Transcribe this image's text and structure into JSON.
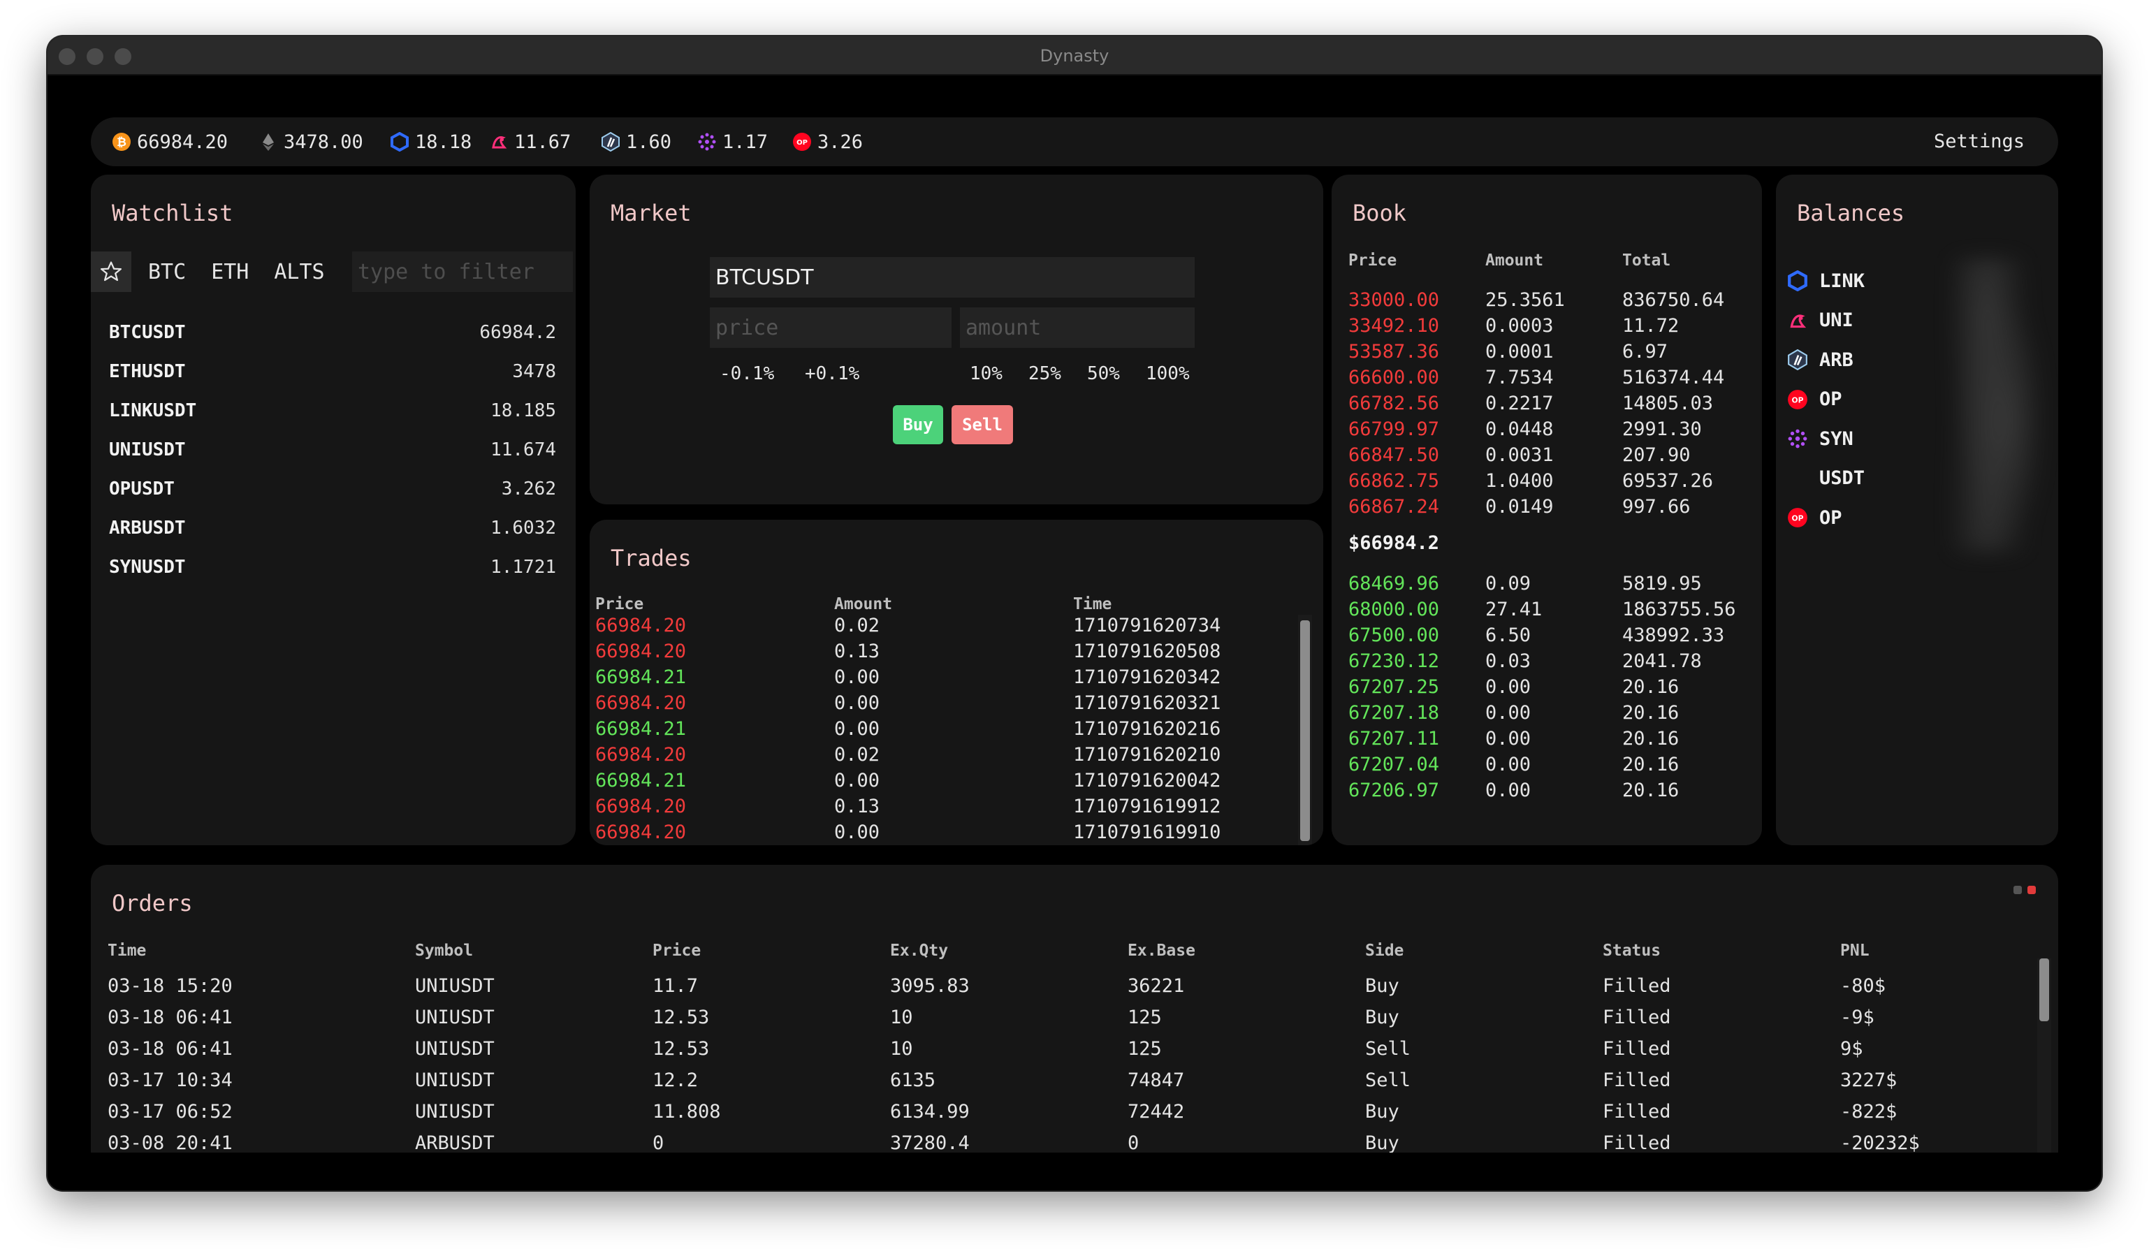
{
  "window": {
    "title": "Dynasty"
  },
  "topbar": {
    "tickers": [
      {
        "icon": "bitcoin-icon",
        "value": "66984.20"
      },
      {
        "icon": "ethereum-icon",
        "value": "3478.00"
      },
      {
        "icon": "chainlink-icon",
        "value": "18.18"
      },
      {
        "icon": "uniswap-icon",
        "value": "11.67"
      },
      {
        "icon": "arbitrum-icon",
        "value": "1.60"
      },
      {
        "icon": "synapse-icon",
        "value": "1.17"
      },
      {
        "icon": "optimism-icon",
        "value": "3.26"
      }
    ],
    "settings_label": "Settings"
  },
  "watchlist": {
    "title": "Watchlist",
    "tabs": [
      "BTC",
      "ETH",
      "ALTS"
    ],
    "filter_placeholder": "type to filter",
    "rows": [
      {
        "symbol": "BTCUSDT",
        "value": "66984.2"
      },
      {
        "symbol": "ETHUSDT",
        "value": "3478"
      },
      {
        "symbol": "LINKUSDT",
        "value": "18.185"
      },
      {
        "symbol": "UNIUSDT",
        "value": "11.674"
      },
      {
        "symbol": "OPUSDT",
        "value": "3.262"
      },
      {
        "symbol": "ARBUSDT",
        "value": "1.6032"
      },
      {
        "symbol": "SYNUSDT",
        "value": "1.1721"
      }
    ]
  },
  "market": {
    "title": "Market",
    "symbol": "BTCUSDT",
    "price_placeholder": "price",
    "amount_placeholder": "amount",
    "price_adjust": [
      "-0.1%",
      "+0.1%"
    ],
    "amount_pct": [
      "10%",
      "25%",
      "50%",
      "100%"
    ],
    "buy_label": "Buy",
    "sell_label": "Sell",
    "colors": {
      "buy": "#4cd27a",
      "sell": "#f07a7a"
    }
  },
  "trades": {
    "title": "Trades",
    "columns": [
      "Price",
      "Amount",
      "Time"
    ],
    "rows": [
      {
        "price": "66984.20",
        "amount": "0.02",
        "time": "1710791620734",
        "side": "sell"
      },
      {
        "price": "66984.20",
        "amount": "0.13",
        "time": "1710791620508",
        "side": "sell"
      },
      {
        "price": "66984.21",
        "amount": "0.00",
        "time": "1710791620342",
        "side": "buy"
      },
      {
        "price": "66984.20",
        "amount": "0.00",
        "time": "1710791620321",
        "side": "sell"
      },
      {
        "price": "66984.21",
        "amount": "0.00",
        "time": "1710791620216",
        "side": "buy"
      },
      {
        "price": "66984.20",
        "amount": "0.02",
        "time": "1710791620210",
        "side": "sell"
      },
      {
        "price": "66984.21",
        "amount": "0.00",
        "time": "1710791620042",
        "side": "buy"
      },
      {
        "price": "66984.20",
        "amount": "0.13",
        "time": "1710791619912",
        "side": "sell"
      },
      {
        "price": "66984.20",
        "amount": "0.00",
        "time": "1710791619910",
        "side": "sell"
      }
    ]
  },
  "book": {
    "title": "Book",
    "columns": [
      "Price",
      "Amount",
      "Total"
    ],
    "asks": [
      {
        "price": "33000.00",
        "amount": "25.3561",
        "total": "836750.64"
      },
      {
        "price": "33492.10",
        "amount": "0.0003",
        "total": "11.72"
      },
      {
        "price": "53587.36",
        "amount": "0.0001",
        "total": "6.97"
      },
      {
        "price": "66600.00",
        "amount": "7.7534",
        "total": "516374.44"
      },
      {
        "price": "66782.56",
        "amount": "0.2217",
        "total": "14805.03"
      },
      {
        "price": "66799.97",
        "amount": "0.0448",
        "total": "2991.30"
      },
      {
        "price": "66847.50",
        "amount": "0.0031",
        "total": "207.90"
      },
      {
        "price": "66862.75",
        "amount": "1.0400",
        "total": "69537.26"
      },
      {
        "price": "66867.24",
        "amount": "0.0149",
        "total": "997.66"
      }
    ],
    "mid_price": "$66984.2",
    "bids": [
      {
        "price": "68469.96",
        "amount": "0.09",
        "total": "5819.95"
      },
      {
        "price": "68000.00",
        "amount": "27.41",
        "total": "1863755.56"
      },
      {
        "price": "67500.00",
        "amount": "6.50",
        "total": "438992.33"
      },
      {
        "price": "67230.12",
        "amount": "0.03",
        "total": "2041.78"
      },
      {
        "price": "67207.25",
        "amount": "0.00",
        "total": "20.16"
      },
      {
        "price": "67207.18",
        "amount": "0.00",
        "total": "20.16"
      },
      {
        "price": "67207.11",
        "amount": "0.00",
        "total": "20.16"
      },
      {
        "price": "67207.04",
        "amount": "0.00",
        "total": "20.16"
      },
      {
        "price": "67206.97",
        "amount": "0.00",
        "total": "20.16"
      }
    ]
  },
  "balances": {
    "title": "Balances",
    "items": [
      {
        "icon": "chainlink-icon",
        "symbol": "LINK"
      },
      {
        "icon": "uniswap-icon",
        "symbol": "UNI"
      },
      {
        "icon": "arbitrum-icon",
        "symbol": "ARB"
      },
      {
        "icon": "optimism-icon",
        "symbol": "OP"
      },
      {
        "icon": "synapse-icon",
        "symbol": "SYN"
      },
      {
        "icon": "",
        "symbol": "USDT"
      },
      {
        "icon": "optimism-icon",
        "symbol": "OP"
      }
    ]
  },
  "orders": {
    "title": "Orders",
    "columns": [
      "Time",
      "Symbol",
      "Price",
      "Ex.Qty",
      "Ex.Base",
      "Side",
      "Status",
      "PNL"
    ],
    "rows": [
      [
        "03-18 15:20",
        "UNIUSDT",
        "11.7",
        "3095.83",
        "36221",
        "Buy",
        "Filled",
        "-80$"
      ],
      [
        "03-18 06:41",
        "UNIUSDT",
        "12.53",
        "10",
        "125",
        "Buy",
        "Filled",
        "-9$"
      ],
      [
        "03-18 06:41",
        "UNIUSDT",
        "12.53",
        "10",
        "125",
        "Sell",
        "Filled",
        "9$"
      ],
      [
        "03-17 10:34",
        "UNIUSDT",
        "12.2",
        "6135",
        "74847",
        "Sell",
        "Filled",
        "3227$"
      ],
      [
        "03-17 06:52",
        "UNIUSDT",
        "11.808",
        "6134.99",
        "72442",
        "Buy",
        "Filled",
        "-822$"
      ],
      [
        "03-08 20:41",
        "ARBUSDT",
        "0",
        "37280.4",
        "0",
        "Buy",
        "Filled",
        "-20232$"
      ]
    ]
  },
  "colors": {
    "ask": "#f23b3b",
    "bid": "#63e55a",
    "title_accent": "#f0c8c8",
    "panel_bg": "#161616"
  }
}
